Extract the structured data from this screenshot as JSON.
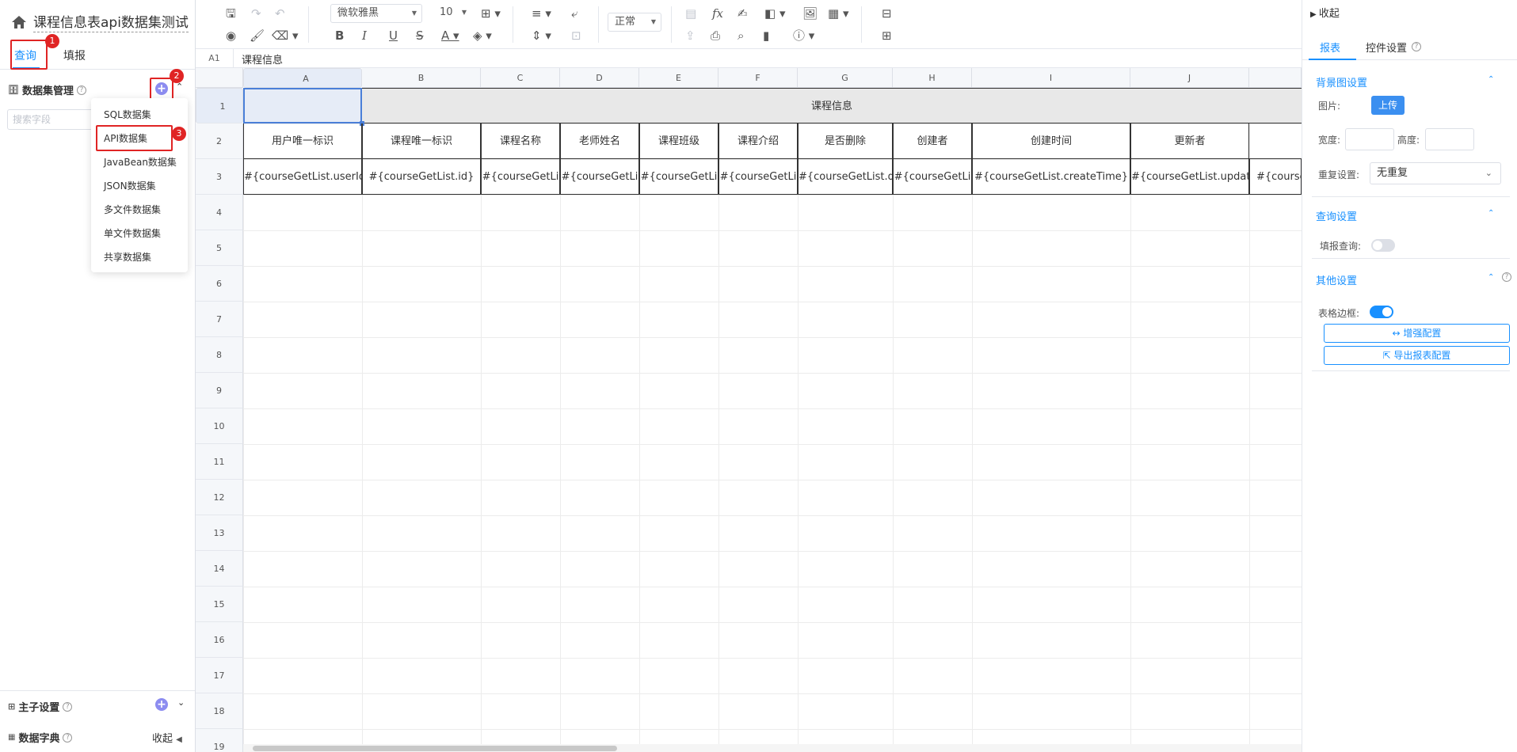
{
  "left_panel": {
    "title": "课程信息表api数据集测试",
    "tabs": [
      "查询",
      "填报"
    ],
    "badges": [
      "1",
      "2",
      "3"
    ],
    "dataset_label": "数据集管理",
    "search_placeholder": "搜索字段",
    "menu_items": [
      "SQL数据集",
      "API数据集",
      "JavaBean数据集",
      "JSON数据集",
      "多文件数据集",
      "单文件数据集",
      "共享数据集"
    ],
    "main_sub_label": "主子设置",
    "dict_label": "数据字典",
    "collapse_label": "收起"
  },
  "toolbar": {
    "font_family": "微软雅黑",
    "font_size": "10",
    "style_select": "正常",
    "icons": [
      "save-icon",
      "redo-icon",
      "undo-icon",
      "eraser-icon",
      "preview-icon",
      "format-painter-icon",
      "bold-icon",
      "italic-icon",
      "underline-icon",
      "strikethrough-icon",
      "font-color-icon",
      "fill-color-icon",
      "border-icon",
      "align-icon",
      "valign-icon",
      "wrap-icon",
      "merge-icon",
      "table-icon",
      "formula-icon",
      "sign-icon",
      "layout-icon",
      "image-icon",
      "qrcode-icon",
      "upload-icon",
      "print-icon",
      "search-icon",
      "chart-icon",
      "help-icon",
      "freeze-icon",
      "insert-icon"
    ]
  },
  "formula_bar": {
    "cell_ref": "A1",
    "value": "课程信息"
  },
  "grid": {
    "columns": [
      "A",
      "B",
      "C",
      "D",
      "E",
      "F",
      "G",
      "H",
      "I",
      "J"
    ],
    "rows": [
      "1",
      "2",
      "3",
      "4",
      "5",
      "6",
      "7",
      "8",
      "9",
      "10",
      "11",
      "12",
      "13",
      "14",
      "15",
      "16",
      "17",
      "18",
      "19"
    ],
    "merged_title": "课程信息",
    "header_row": [
      "用户唯一标识",
      "课程唯一标识",
      "课程名称",
      "老师姓名",
      "课程班级",
      "课程介绍",
      "是否删除",
      "创建者",
      "创建时间",
      "更新者"
    ],
    "data_row": [
      "#{courseGetList.userId",
      "#{courseGetList.id}",
      "#{courseGetLi",
      "#{courseGetLi",
      "#{courseGetLi",
      "#{courseGetLi",
      "#{courseGetList.d",
      "#{courseGetLi",
      "#{courseGetList.createTime}",
      "#{courseGetList.updat",
      "#{course"
    ]
  },
  "right_panel": {
    "collapse_label": "收起",
    "tabs": [
      "报表",
      "控件设置"
    ],
    "bg_section": "背景图设置",
    "image_label": "图片:",
    "upload_label": "上传",
    "width_label": "宽度:",
    "height_label": "高度:",
    "repeat_label": "重复设置:",
    "repeat_value": "无重复",
    "query_section": "查询设置",
    "fill_query_label": "填报查询:",
    "other_section": "其他设置",
    "border_label": "表格边框:",
    "enhance_label": "增强配置",
    "export_label": "导出报表配置"
  },
  "colors": {
    "accent": "#1890ff",
    "highlight": "#e02424",
    "title_cell": "#e8e8e8"
  }
}
